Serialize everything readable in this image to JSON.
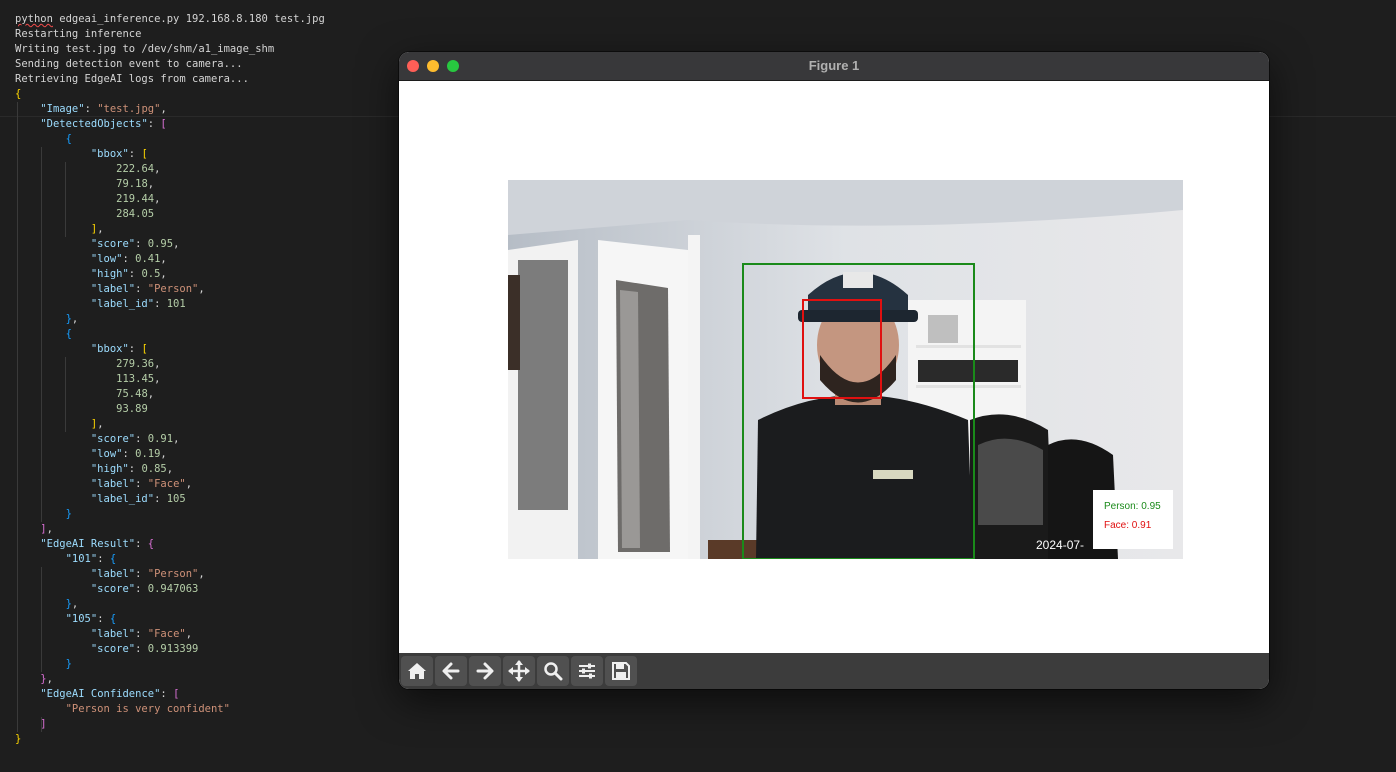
{
  "terminal": {
    "cmd_name": "python",
    "cmd_rest": " edgeai_inference.py 192.168.8.180 test.jpg",
    "log_lines": [
      "Restarting inference",
      "Writing test.jpg to /dev/shm/a1_image_shm",
      "Sending detection event to camera...",
      "Retrieving EdgeAI logs from camera..."
    ],
    "json_lines": [
      [
        [
          "b1",
          "{"
        ]
      ],
      [
        [
          "p",
          "    "
        ],
        [
          "k",
          "\"Image\""
        ],
        [
          "p",
          ": "
        ],
        [
          "s",
          "\"test.jpg\""
        ],
        [
          "p",
          ","
        ]
      ],
      [
        [
          "p",
          "    "
        ],
        [
          "k",
          "\"DetectedObjects\""
        ],
        [
          "p",
          ": "
        ],
        [
          "b2",
          "["
        ]
      ],
      [
        [
          "p",
          "        "
        ],
        [
          "b3",
          "{"
        ]
      ],
      [
        [
          "p",
          "            "
        ],
        [
          "k",
          "\"bbox\""
        ],
        [
          "p",
          ": "
        ],
        [
          "b1",
          "["
        ]
      ],
      [
        [
          "p",
          "                "
        ],
        [
          "n",
          "222.64"
        ],
        [
          "p",
          ","
        ]
      ],
      [
        [
          "p",
          "                "
        ],
        [
          "n",
          "79.18"
        ],
        [
          "p",
          ","
        ]
      ],
      [
        [
          "p",
          "                "
        ],
        [
          "n",
          "219.44"
        ],
        [
          "p",
          ","
        ]
      ],
      [
        [
          "p",
          "                "
        ],
        [
          "n",
          "284.05"
        ]
      ],
      [
        [
          "p",
          "            "
        ],
        [
          "b1",
          "]"
        ],
        [
          "p",
          ","
        ]
      ],
      [
        [
          "p",
          "            "
        ],
        [
          "k",
          "\"score\""
        ],
        [
          "p",
          ": "
        ],
        [
          "n",
          "0.95"
        ],
        [
          "p",
          ","
        ]
      ],
      [
        [
          "p",
          "            "
        ],
        [
          "k",
          "\"low\""
        ],
        [
          "p",
          ": "
        ],
        [
          "n",
          "0.41"
        ],
        [
          "p",
          ","
        ]
      ],
      [
        [
          "p",
          "            "
        ],
        [
          "k",
          "\"high\""
        ],
        [
          "p",
          ": "
        ],
        [
          "n",
          "0.5"
        ],
        [
          "p",
          ","
        ]
      ],
      [
        [
          "p",
          "            "
        ],
        [
          "k",
          "\"label\""
        ],
        [
          "p",
          ": "
        ],
        [
          "s",
          "\"Person\""
        ],
        [
          "p",
          ","
        ]
      ],
      [
        [
          "p",
          "            "
        ],
        [
          "k",
          "\"label_id\""
        ],
        [
          "p",
          ": "
        ],
        [
          "n",
          "101"
        ]
      ],
      [
        [
          "p",
          "        "
        ],
        [
          "b3",
          "}"
        ],
        [
          "p",
          ","
        ]
      ],
      [
        [
          "p",
          "        "
        ],
        [
          "b3",
          "{"
        ]
      ],
      [
        [
          "p",
          "            "
        ],
        [
          "k",
          "\"bbox\""
        ],
        [
          "p",
          ": "
        ],
        [
          "b1",
          "["
        ]
      ],
      [
        [
          "p",
          "                "
        ],
        [
          "n",
          "279.36"
        ],
        [
          "p",
          ","
        ]
      ],
      [
        [
          "p",
          "                "
        ],
        [
          "n",
          "113.45"
        ],
        [
          "p",
          ","
        ]
      ],
      [
        [
          "p",
          "                "
        ],
        [
          "n",
          "75.48"
        ],
        [
          "p",
          ","
        ]
      ],
      [
        [
          "p",
          "                "
        ],
        [
          "n",
          "93.89"
        ]
      ],
      [
        [
          "p",
          "            "
        ],
        [
          "b1",
          "]"
        ],
        [
          "p",
          ","
        ]
      ],
      [
        [
          "p",
          "            "
        ],
        [
          "k",
          "\"score\""
        ],
        [
          "p",
          ": "
        ],
        [
          "n",
          "0.91"
        ],
        [
          "p",
          ","
        ]
      ],
      [
        [
          "p",
          "            "
        ],
        [
          "k",
          "\"low\""
        ],
        [
          "p",
          ": "
        ],
        [
          "n",
          "0.19"
        ],
        [
          "p",
          ","
        ]
      ],
      [
        [
          "p",
          "            "
        ],
        [
          "k",
          "\"high\""
        ],
        [
          "p",
          ": "
        ],
        [
          "n",
          "0.85"
        ],
        [
          "p",
          ","
        ]
      ],
      [
        [
          "p",
          "            "
        ],
        [
          "k",
          "\"label\""
        ],
        [
          "p",
          ": "
        ],
        [
          "s",
          "\"Face\""
        ],
        [
          "p",
          ","
        ]
      ],
      [
        [
          "p",
          "            "
        ],
        [
          "k",
          "\"label_id\""
        ],
        [
          "p",
          ": "
        ],
        [
          "n",
          "105"
        ]
      ],
      [
        [
          "p",
          "        "
        ],
        [
          "b3",
          "}"
        ]
      ],
      [
        [
          "p",
          "    "
        ],
        [
          "b2",
          "]"
        ],
        [
          "p",
          ","
        ]
      ],
      [
        [
          "p",
          "    "
        ],
        [
          "k",
          "\"EdgeAI Result\""
        ],
        [
          "p",
          ": "
        ],
        [
          "b2",
          "{"
        ]
      ],
      [
        [
          "p",
          "        "
        ],
        [
          "k",
          "\"101\""
        ],
        [
          "p",
          ": "
        ],
        [
          "b3",
          "{"
        ]
      ],
      [
        [
          "p",
          "            "
        ],
        [
          "k",
          "\"label\""
        ],
        [
          "p",
          ": "
        ],
        [
          "s",
          "\"Person\""
        ],
        [
          "p",
          ","
        ]
      ],
      [
        [
          "p",
          "            "
        ],
        [
          "k",
          "\"score\""
        ],
        [
          "p",
          ": "
        ],
        [
          "n",
          "0.947063"
        ]
      ],
      [
        [
          "p",
          "        "
        ],
        [
          "b3",
          "}"
        ],
        [
          "p",
          ","
        ]
      ],
      [
        [
          "p",
          "        "
        ],
        [
          "k",
          "\"105\""
        ],
        [
          "p",
          ": "
        ],
        [
          "b3",
          "{"
        ]
      ],
      [
        [
          "p",
          "            "
        ],
        [
          "k",
          "\"label\""
        ],
        [
          "p",
          ": "
        ],
        [
          "s",
          "\"Face\""
        ],
        [
          "p",
          ","
        ]
      ],
      [
        [
          "p",
          "            "
        ],
        [
          "k",
          "\"score\""
        ],
        [
          "p",
          ": "
        ],
        [
          "n",
          "0.913399"
        ]
      ],
      [
        [
          "p",
          "        "
        ],
        [
          "b3",
          "}"
        ]
      ],
      [
        [
          "p",
          "    "
        ],
        [
          "b2",
          "}"
        ],
        [
          "p",
          ","
        ]
      ],
      [
        [
          "p",
          "    "
        ],
        [
          "k",
          "\"EdgeAI Confidence\""
        ],
        [
          "p",
          ": "
        ],
        [
          "b2",
          "["
        ]
      ],
      [
        [
          "p",
          "        "
        ],
        [
          "s",
          "\"Person is very confident\""
        ]
      ],
      [
        [
          "p",
          "    "
        ],
        [
          "b2",
          "]"
        ]
      ],
      [
        [
          "b1",
          "}"
        ]
      ]
    ]
  },
  "figure": {
    "title": "Figure 1",
    "legend_person": "Person: 0.95",
    "legend_face": "Face: 0.91",
    "timestamp": "2024-07-",
    "colors": {
      "person_box": "#1a8a1a",
      "face_box": "#e01010"
    },
    "toolbar": [
      {
        "name": "home-button",
        "icon": "home-icon"
      },
      {
        "name": "back-button",
        "icon": "arrow-left-icon"
      },
      {
        "name": "forward-button",
        "icon": "arrow-right-icon"
      },
      {
        "name": "pan-button",
        "icon": "move-icon"
      },
      {
        "name": "zoom-button",
        "icon": "magnifier-icon"
      },
      {
        "name": "configure-subplots-button",
        "icon": "sliders-icon"
      },
      {
        "name": "save-button",
        "icon": "floppy-disk-icon"
      }
    ]
  }
}
